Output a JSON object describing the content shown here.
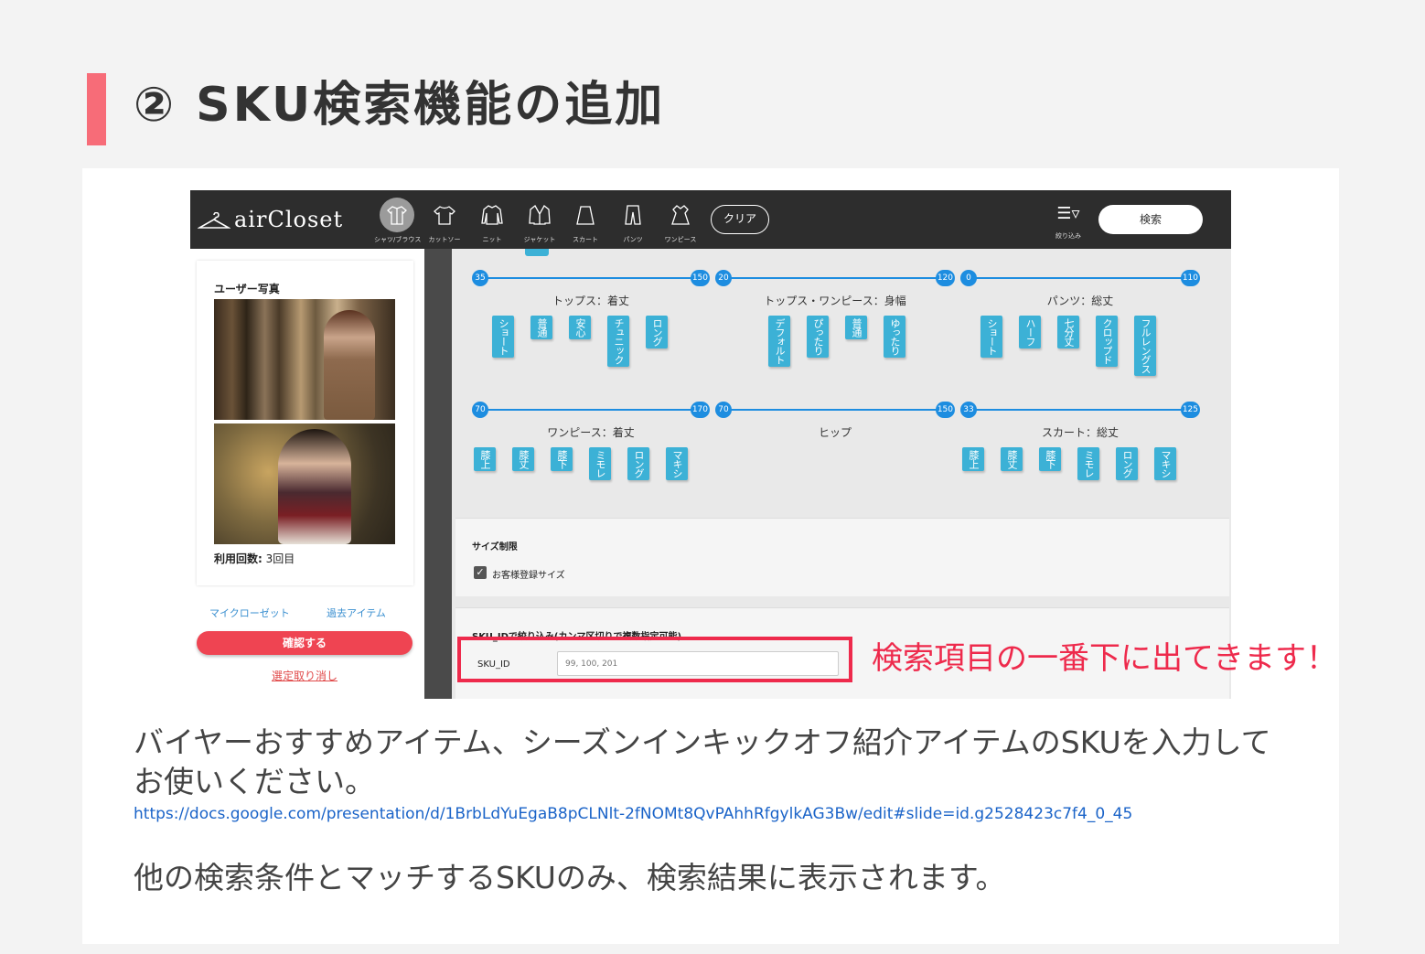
{
  "slide": {
    "title": "② SKU検索機能の追加",
    "description1": "バイヤーおすすめアイテム、シーズンインキックオフ紹介アイテムのSKUを入力してお使いください。",
    "link": "https://docs.google.com/presentation/d/1BrbLdYuEgaB8pCLNlt-2fNOMt8QvPAhhRfgylkAG3Bw/edit#slide=id.g2528423c7f4_0_45",
    "description2": "他の検索条件とマッチするSKUのみ、検索結果に表示されます。",
    "callout": "検索項目の一番下に出てきます！",
    "colors": {
      "accent": "#f76c78",
      "callout": "#ee2a4c",
      "link": "#1a63c8"
    }
  },
  "app": {
    "logo": "airCloset",
    "categories": [
      {
        "label": "シャツ/ブラウス",
        "icon": "shirt-icon",
        "active": true
      },
      {
        "label": "カットソー",
        "icon": "tshirt-icon"
      },
      {
        "label": "ニット",
        "icon": "knit-icon"
      },
      {
        "label": "ジャケット",
        "icon": "jacket-icon"
      },
      {
        "label": "スカート",
        "icon": "skirt-icon"
      },
      {
        "label": "パンツ",
        "icon": "pants-icon"
      },
      {
        "label": "ワンピース",
        "icon": "dress-icon"
      }
    ],
    "clear_label": "クリア",
    "filter_label": "絞り込み",
    "search_label": "検索",
    "user_photo_title": "ユーザー写真",
    "usage_label": "利用回数:",
    "usage_value": "3回目",
    "tabs": [
      "マイクローゼット",
      "過去アイテム"
    ],
    "confirm_label": "確認する",
    "cancel_label": "選定取り消し",
    "groups": [
      {
        "title": "トップス：着丈",
        "min": "35",
        "max": "150",
        "chips": [
          "ショート",
          "普通",
          "安心",
          "チュニック",
          "ロング"
        ]
      },
      {
        "title": "トップス・ワンピース：身幅",
        "min": "20",
        "max": "120",
        "chips": [
          "デフォルト",
          "ぴったり",
          "普通",
          "ゆったり"
        ]
      },
      {
        "title": "パンツ：総丈",
        "min": "0",
        "max": "110",
        "chips": [
          "ショート",
          "ハーフ",
          "七分丈",
          "クロップド",
          "フルレングス"
        ]
      },
      {
        "title": "ワンピース：着丈",
        "min": "70",
        "max": "170",
        "chips": [
          "膝上",
          "膝丈",
          "膝下",
          "ミモレ",
          "ロング",
          "マキシ"
        ]
      },
      {
        "title": "ヒップ",
        "min": "70",
        "max": "150",
        "chips": []
      },
      {
        "title": "スカート：総丈",
        "min": "33",
        "max": "125",
        "chips": [
          "膝上",
          "膝丈",
          "膝下",
          "ミモレ",
          "ロング",
          "マキシ"
        ]
      }
    ],
    "size_title": "サイズ制限",
    "size_checkbox_label": "お客様登録サイズ",
    "size_checkbox_checked": true,
    "sku_title": "SKU_IDで絞り込み(カンマ区切りで複数指定可能)",
    "sku_label": "SKU_ID",
    "sku_placeholder": "99, 100, 201",
    "sku_value": ""
  }
}
